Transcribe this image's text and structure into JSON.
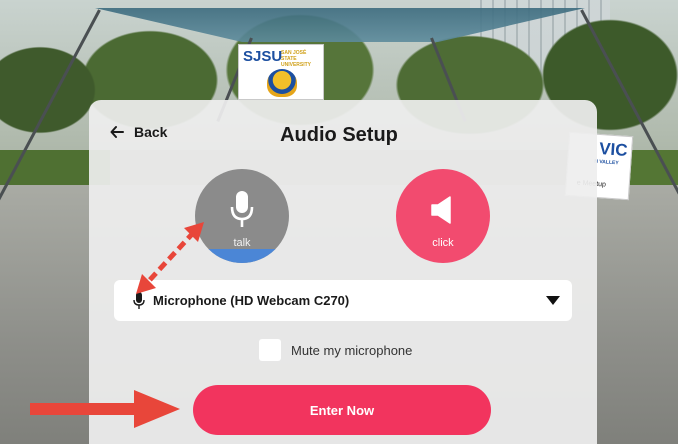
{
  "background": {
    "sjsu_banner": {
      "logo_text": "SJSU",
      "sub_text": "SAN JOSÉ STATE UNIVERSITY"
    },
    "svic_banner": {
      "logo_text": "VIC",
      "sub_text": "N VALLEY",
      "caption": "e Meetup"
    }
  },
  "header": {
    "back_label": "Back",
    "title": "Audio Setup"
  },
  "talk_button": {
    "label": "talk",
    "level_fraction": 0.15,
    "color": "#8b8b8b",
    "level_color": "#4b86d6"
  },
  "click_button": {
    "label": "click",
    "color": "#f24b6f"
  },
  "microphone_select": {
    "selected": "Microphone (HD Webcam C270)"
  },
  "mute": {
    "label": "Mute my microphone",
    "checked": false
  },
  "enter_button": {
    "label": "Enter Now",
    "color": "#f2345e"
  },
  "annotation_color": "#e8463a"
}
